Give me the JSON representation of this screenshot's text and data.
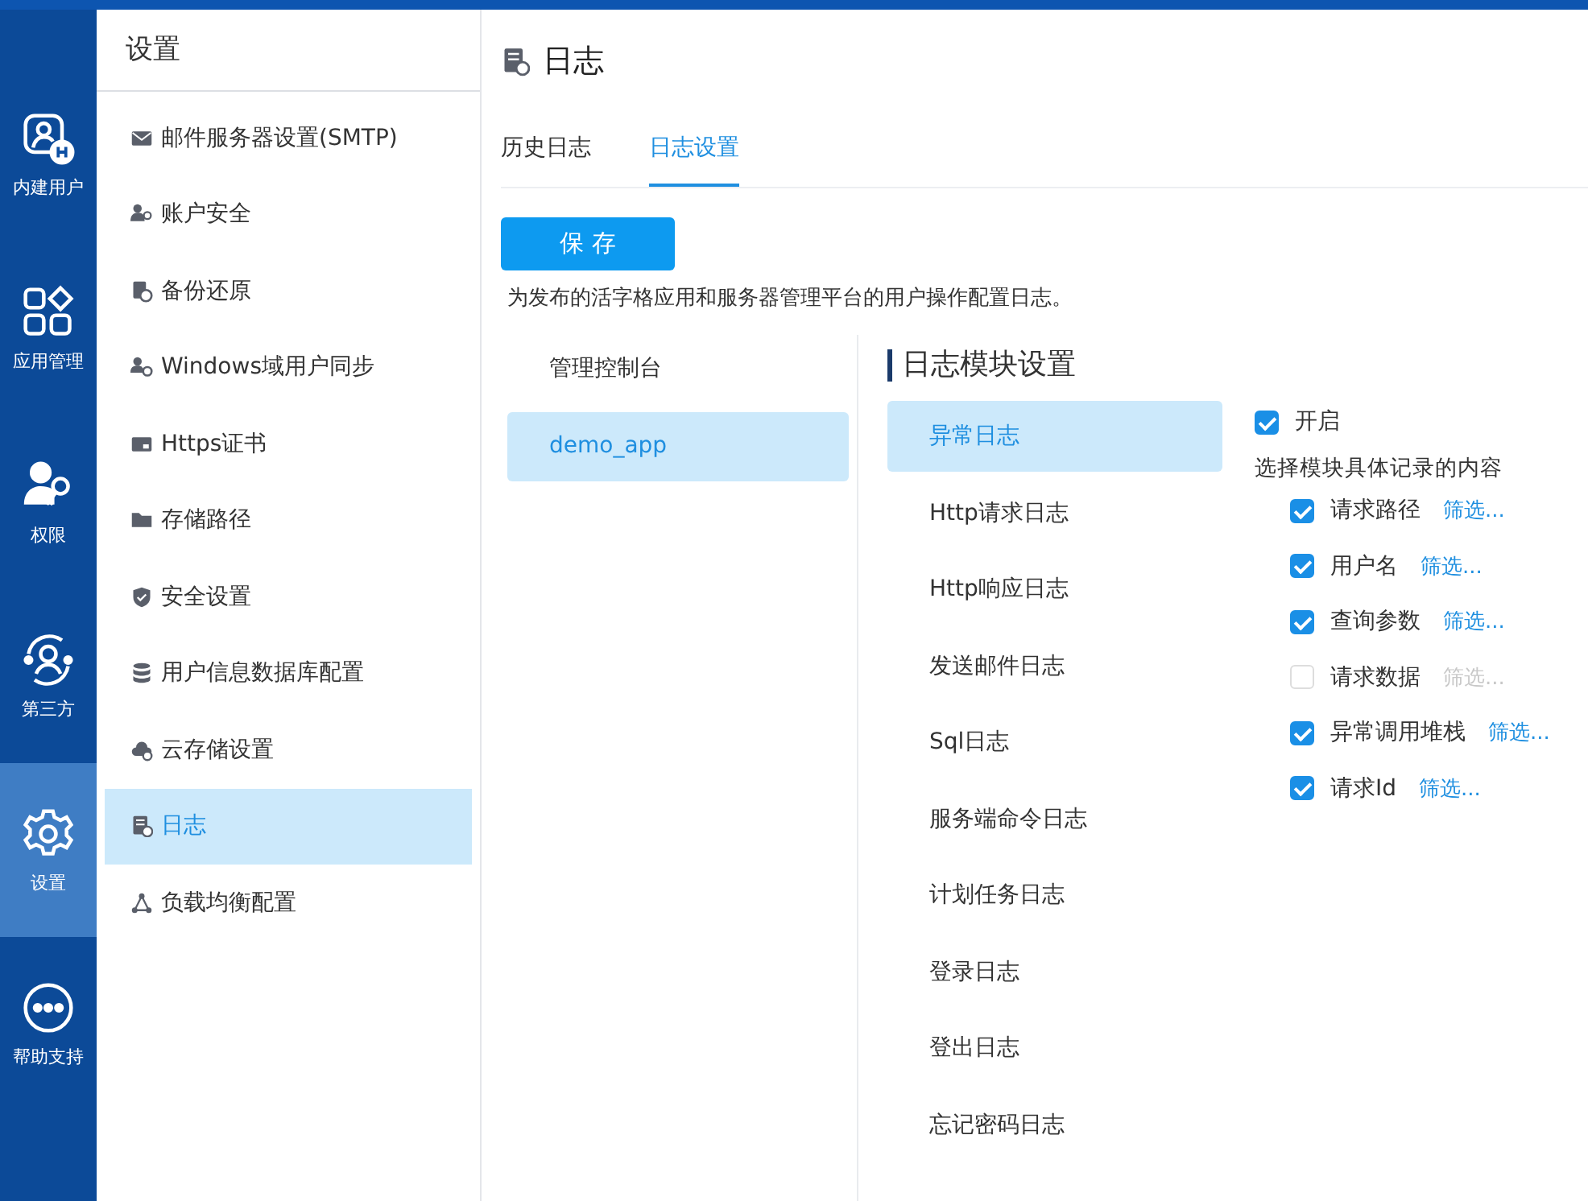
{
  "rail": [
    {
      "label": "内建用户",
      "selected": false
    },
    {
      "label": "应用管理",
      "selected": false
    },
    {
      "label": "权限",
      "selected": false
    },
    {
      "label": "第三方",
      "selected": false
    },
    {
      "label": "设置",
      "selected": true
    },
    {
      "label": "帮助支持",
      "selected": false
    }
  ],
  "sidebar": {
    "title": "设置",
    "items": [
      {
        "label": "邮件服务器设置(SMTP)",
        "selected": false
      },
      {
        "label": "账户安全",
        "selected": false
      },
      {
        "label": "备份还原",
        "selected": false
      },
      {
        "label": "Windows域用户同步",
        "selected": false
      },
      {
        "label": "Https证书",
        "selected": false
      },
      {
        "label": "存储路径",
        "selected": false
      },
      {
        "label": "安全设置",
        "selected": false
      },
      {
        "label": "用户信息数据库配置",
        "selected": false
      },
      {
        "label": "云存储设置",
        "selected": false
      },
      {
        "label": "日志",
        "selected": true
      },
      {
        "label": "负载均衡配置",
        "selected": false
      }
    ]
  },
  "page": {
    "title": "日志",
    "tabs": [
      {
        "label": "历史日志",
        "selected": false
      },
      {
        "label": "日志设置",
        "selected": true
      }
    ],
    "save_button": "保 存",
    "description": "为发布的活字格应用和服务器管理平台的用户操作配置日志。",
    "apps": [
      {
        "label": "管理控制台",
        "selected": false
      },
      {
        "label": "demo_app",
        "selected": true
      }
    ],
    "module_heading": "日志模块设置",
    "modules": [
      {
        "label": "异常日志",
        "selected": true
      },
      {
        "label": "Http请求日志",
        "selected": false
      },
      {
        "label": "Http响应日志",
        "selected": false
      },
      {
        "label": "发送邮件日志",
        "selected": false
      },
      {
        "label": "Sql日志",
        "selected": false
      },
      {
        "label": "服务端命令日志",
        "selected": false
      },
      {
        "label": "计划任务日志",
        "selected": false
      },
      {
        "label": "登录日志",
        "selected": false
      },
      {
        "label": "登出日志",
        "selected": false
      },
      {
        "label": "忘记密码日志",
        "selected": false
      }
    ],
    "enable": {
      "label": "开启",
      "checked": true
    },
    "options_heading": "选择模块具体记录的内容",
    "options": [
      {
        "label": "请求路径",
        "checked": true,
        "filter": "筛选..."
      },
      {
        "label": "用户名",
        "checked": true,
        "filter": "筛选..."
      },
      {
        "label": "查询参数",
        "checked": true,
        "filter": "筛选..."
      },
      {
        "label": "请求数据",
        "checked": false,
        "filter": "筛选..."
      },
      {
        "label": "异常调用堆栈",
        "checked": true,
        "filter": "筛选..."
      },
      {
        "label": "请求Id",
        "checked": true,
        "filter": "筛选..."
      }
    ]
  }
}
